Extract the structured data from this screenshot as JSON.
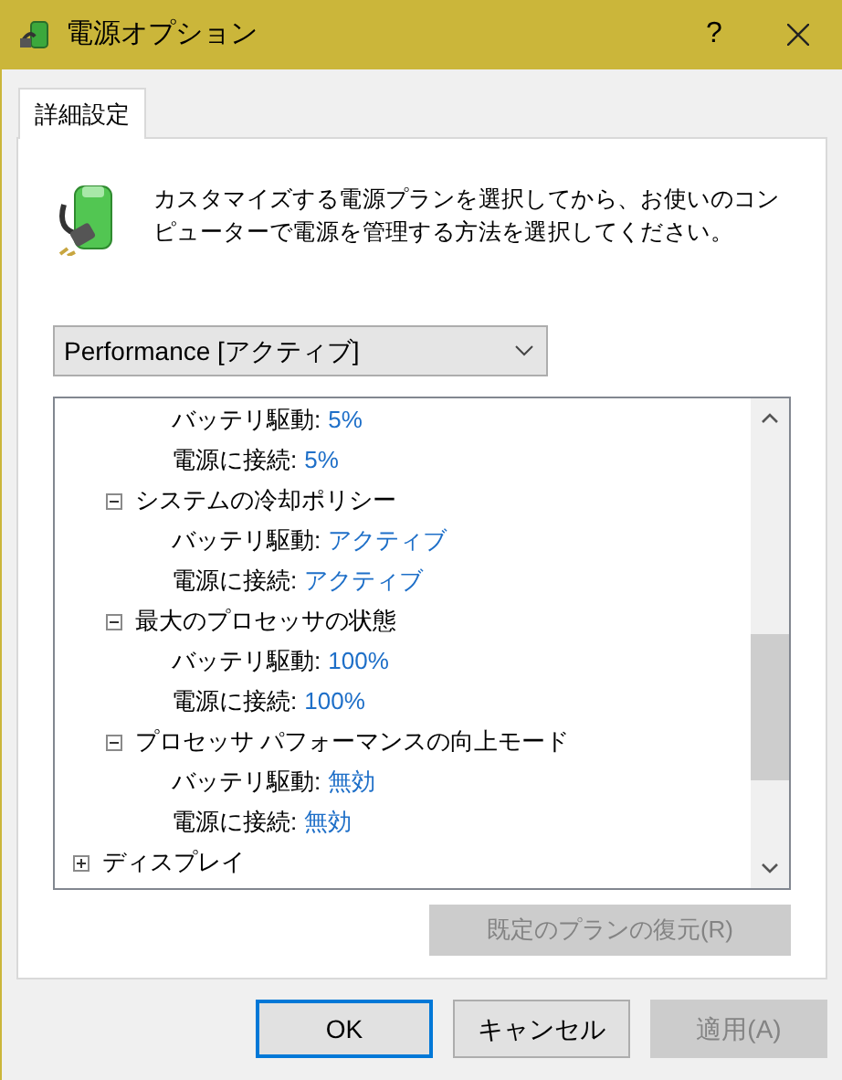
{
  "window": {
    "title": "電源オプション",
    "help": "?"
  },
  "tabs": [
    {
      "label": "詳細設定",
      "selected": true
    }
  ],
  "description": "カスタマイズする電源プランを選択してから、お使いのコンピューターで電源を管理する方法を選択してください。",
  "plan_dropdown": {
    "value": "Performance [アクティブ]"
  },
  "tree": [
    {
      "children": [
        {
          "children": [
            {
              "label": "バッテリ駆動:",
              "value": "5%"
            },
            {
              "label": "電源に接続:",
              "value": "5%"
            }
          ]
        },
        {
          "label": "システムの冷却ポリシー",
          "expanded": true,
          "children": [
            {
              "label": "バッテリ駆動:",
              "value": "アクティブ"
            },
            {
              "label": "電源に接続:",
              "value": "アクティブ"
            }
          ]
        },
        {
          "label": "最大のプロセッサの状態",
          "expanded": true,
          "children": [
            {
              "label": "バッテリ駆動:",
              "value": "100%"
            },
            {
              "label": "電源に接続:",
              "value": "100%"
            }
          ]
        },
        {
          "label": "プロセッサ パフォーマンスの向上モード",
          "expanded": true,
          "children": [
            {
              "label": "バッテリ駆動:",
              "value": "無効"
            },
            {
              "label": "電源に接続:",
              "value": "無効"
            }
          ]
        }
      ]
    },
    {
      "label": "ディスプレイ",
      "expanded": false
    }
  ],
  "restore_button": {
    "label": "既定のプランの復元(R)",
    "disabled": true
  },
  "buttons": [
    {
      "label": "OK",
      "disabled": false,
      "default": true
    },
    {
      "label": "キャンセル",
      "disabled": false,
      "default": false
    },
    {
      "label": "適用(A)",
      "disabled": true,
      "default": false
    }
  ]
}
